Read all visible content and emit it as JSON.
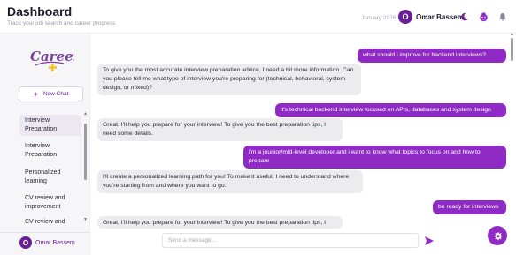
{
  "header": {
    "title": "Dashboard",
    "subtitle": "Track your job search and career progress",
    "date": "January 2026",
    "user_initial": "O",
    "user_name": "Omar Bassem",
    "icons": [
      "moon-icon",
      "smiley-icon",
      "bell-icon"
    ]
  },
  "sidebar": {
    "logo_text": "Careerly",
    "new_chat_label": "New Chat",
    "history": [
      {
        "label": "Interview Preparation",
        "active": true
      },
      {
        "label": "Interview Preparation",
        "active": false
      },
      {
        "label": "Personalized learning",
        "active": false
      },
      {
        "label": "CV review and improvement",
        "active": false
      },
      {
        "label": "CV review and",
        "active": false
      }
    ],
    "user_initial": "O",
    "user_name": "Omar Bassem"
  },
  "messages": [
    {
      "role": "user",
      "text": "what should i improve for backend interviews?"
    },
    {
      "role": "assistant",
      "text": "To give you the most accurate interview preparation advice, I need a bit more information. Can you please tell me what type of interview you're preparing for (technical, behavioral, system design, or mixed)?"
    },
    {
      "role": "user",
      "text": "it's technical backend interview focused on APIs, databases and system design"
    },
    {
      "role": "assistant",
      "text": "Great, I'll help you prepare for your interview! To give you the best preparation tips, I need some details."
    },
    {
      "role": "user",
      "text": "i'm a jounior/mid-level developer and i want to know what topics to focus on and how to prepare"
    },
    {
      "role": "assistant",
      "text": "I'll create a personalized learning path for you! To make it useful, I need to understand where you're starting from and where you want to go."
    },
    {
      "role": "user",
      "text": "be ready for interviews"
    },
    {
      "role": "assistant",
      "text": "Great, I'll help you prepare for your interview! To give you the best preparation tips, I need some details."
    }
  ],
  "input": {
    "placeholder": "Send a message..."
  },
  "colors": {
    "accent": "#8f2bc4",
    "accent_dark": "#6b1d96",
    "assistant_bubble": "#ececef"
  }
}
